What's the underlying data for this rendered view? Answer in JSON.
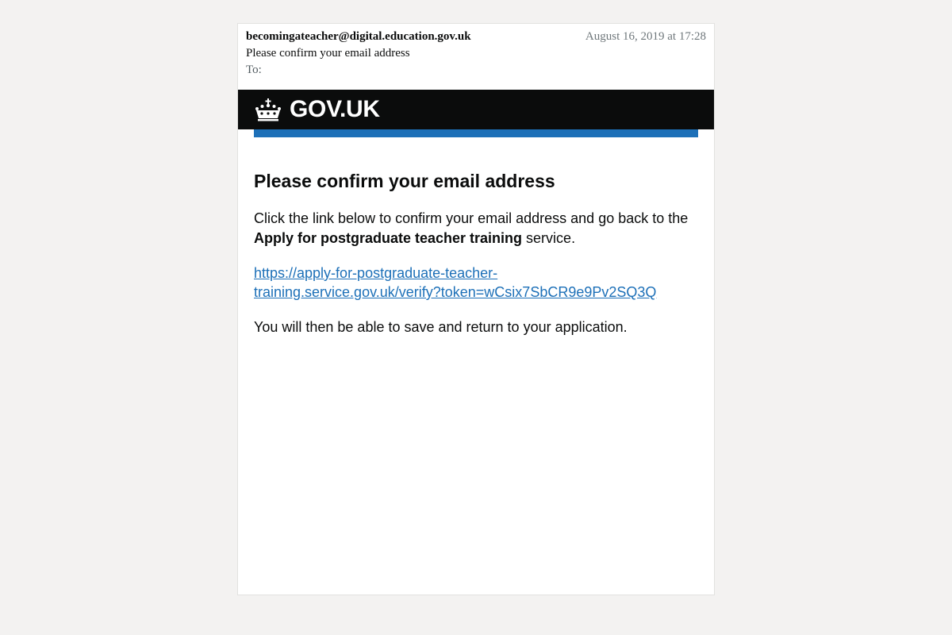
{
  "header": {
    "from": "becomingateacher@digital.education.gov.uk",
    "date": "August 16, 2019 at 17:28",
    "subject": "Please confirm your email address",
    "to_label": "To:"
  },
  "banner": {
    "logotype": "GOV.UK",
    "icon": "crown-icon",
    "background_color": "#0b0c0c",
    "accent_color": "#1d70b8"
  },
  "body": {
    "heading": "Please confirm your email address",
    "intro_before": "Click the link below to confirm your email address and go back to the ",
    "service_name": "Apply for postgraduate teacher training",
    "intro_after": " service.",
    "link_line_1": "https://apply-for-postgraduate-teacher-",
    "link_line_2": "training.service.gov.uk/verify?token=wCsix7SbCR9e9Pv2SQ3Q",
    "outro": "You will then be able to save and return to your application."
  }
}
